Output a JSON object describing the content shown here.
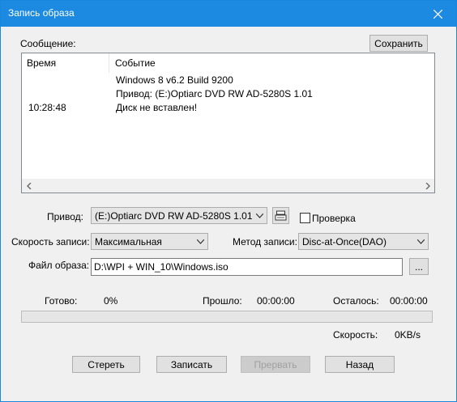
{
  "window": {
    "title": "Запись образа"
  },
  "log": {
    "section_label": "Сообщение:",
    "save_label": "Сохранить",
    "columns": {
      "time": "Время",
      "event": "Событие"
    },
    "rows": [
      {
        "time": "",
        "event": "Windows 8 v6.2 Build 9200"
      },
      {
        "time": "",
        "event": "Привод: (E:)Optiarc DVD RW AD-5280S 1.01"
      },
      {
        "time": "10:28:48",
        "event": "Диск не вставлен!"
      }
    ]
  },
  "drive": {
    "label": "Привод:",
    "value": "(E:)Optiarc DVD RW AD-5280S 1.01"
  },
  "verify": {
    "label": "Проверка",
    "checked": false
  },
  "speed": {
    "label": "Скорость записи:",
    "value": "Максимальная"
  },
  "method": {
    "label": "Метод записи:",
    "value": "Disc-at-Once(DAO)"
  },
  "image_file": {
    "label": "Файл образа:",
    "value": "D:\\WPI + WIN_10\\Windows.iso",
    "browse_label": "..."
  },
  "status": {
    "ready_label": "Готово:",
    "ready_value": "0%",
    "elapsed_label": "Прошло:",
    "elapsed_value": "00:00:00",
    "remaining_label": "Осталось:",
    "remaining_value": "00:00:00",
    "speed_label": "Скорость:",
    "speed_value": "0KB/s",
    "progress_fraction": 0
  },
  "buttons": {
    "erase": "Стереть",
    "write": "Записать",
    "abort": "Прервать",
    "back": "Назад"
  }
}
